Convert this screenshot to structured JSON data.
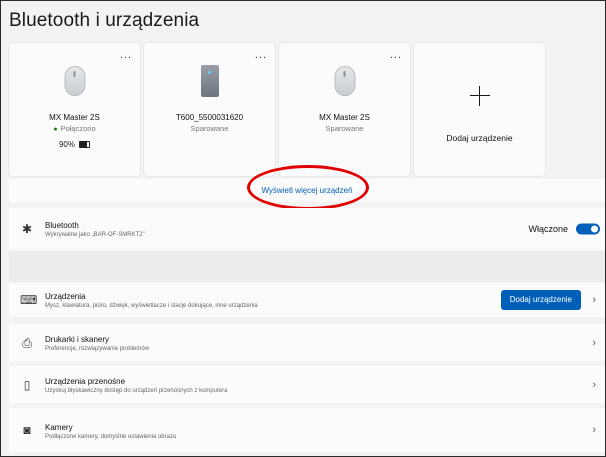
{
  "page": {
    "title": "Bluetooth i urządzenia"
  },
  "devices": [
    {
      "name": "MX Master 2S",
      "status": "Połączono",
      "battery": "90%",
      "icon": "mouse-icon"
    },
    {
      "name": "T600_5500031620",
      "status": "Sparowane",
      "icon": "pc-icon"
    },
    {
      "name": "MX Master 2S",
      "status": "Sparowane",
      "icon": "mouse-icon"
    }
  ],
  "add_device_card": {
    "label": "Dodaj urządzenie",
    "icon": "plus-icon"
  },
  "more_menu": "...",
  "more_devices_link": "Wyświetl więcej urządzeń",
  "annotation_color": "#e00000",
  "accent_color": "#005fb8",
  "bluetooth": {
    "title": "Bluetooth",
    "subtitle": "Wykrywalne jako „BAR-OF-SMRKT2\"",
    "toggle_label": "Włączone",
    "toggle_on": true
  },
  "rows": [
    {
      "title": "Urządzenia",
      "subtitle": "Mysz, klawiatura, pióro, dźwięk, wyświetlacze i stacje dokujące, inne urządzenia",
      "button": "Dodaj urządzenie",
      "icon": "devices-icon"
    },
    {
      "title": "Drukarki i skanery",
      "subtitle": "Preferencje, rozwiązywanie problemów",
      "icon": "printer-icon"
    },
    {
      "title": "Urządzenia przenośne",
      "subtitle": "Uzyskuj błyskawiczny dostęp do urządzeń przenośnych z komputera",
      "icon": "phone-icon"
    },
    {
      "title": "Kamery",
      "subtitle": "Podłączone kamery, domyślne ustawienia obrazu",
      "icon": "camera-icon"
    }
  ]
}
